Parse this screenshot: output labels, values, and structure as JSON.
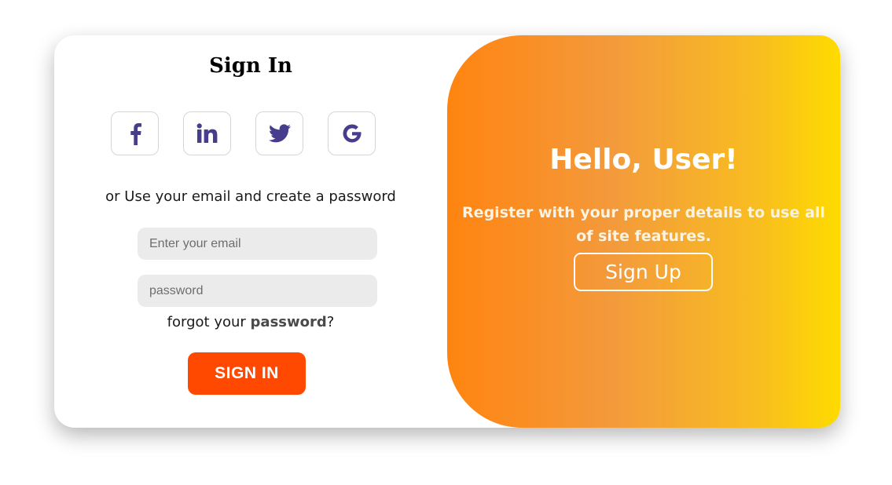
{
  "signin": {
    "title": "Sign In",
    "social": [
      {
        "icon": "facebook-icon",
        "glyph": "f"
      },
      {
        "icon": "linkedin-icon",
        "glyph": "in"
      },
      {
        "icon": "twitter-icon",
        "glyph": ""
      },
      {
        "icon": "google-icon",
        "glyph": "G"
      }
    ],
    "alt_text": "or Use your email and create a password",
    "email": {
      "placeholder": "Enter your email",
      "value": ""
    },
    "password": {
      "placeholder": "password",
      "value": ""
    },
    "forgot_prefix": "forgot your ",
    "forgot_strong": "password",
    "forgot_suffix": "?",
    "button_label": "SIGN IN"
  },
  "overlay": {
    "title": "Hello, User!",
    "text": "Register with your proper details to use all of site features.",
    "button_label": "Sign Up"
  },
  "colors": {
    "icon": "#463d8c",
    "signin_button": "#ff4800",
    "gradient_start": "#ff8410",
    "gradient_end": "#fedb00"
  }
}
